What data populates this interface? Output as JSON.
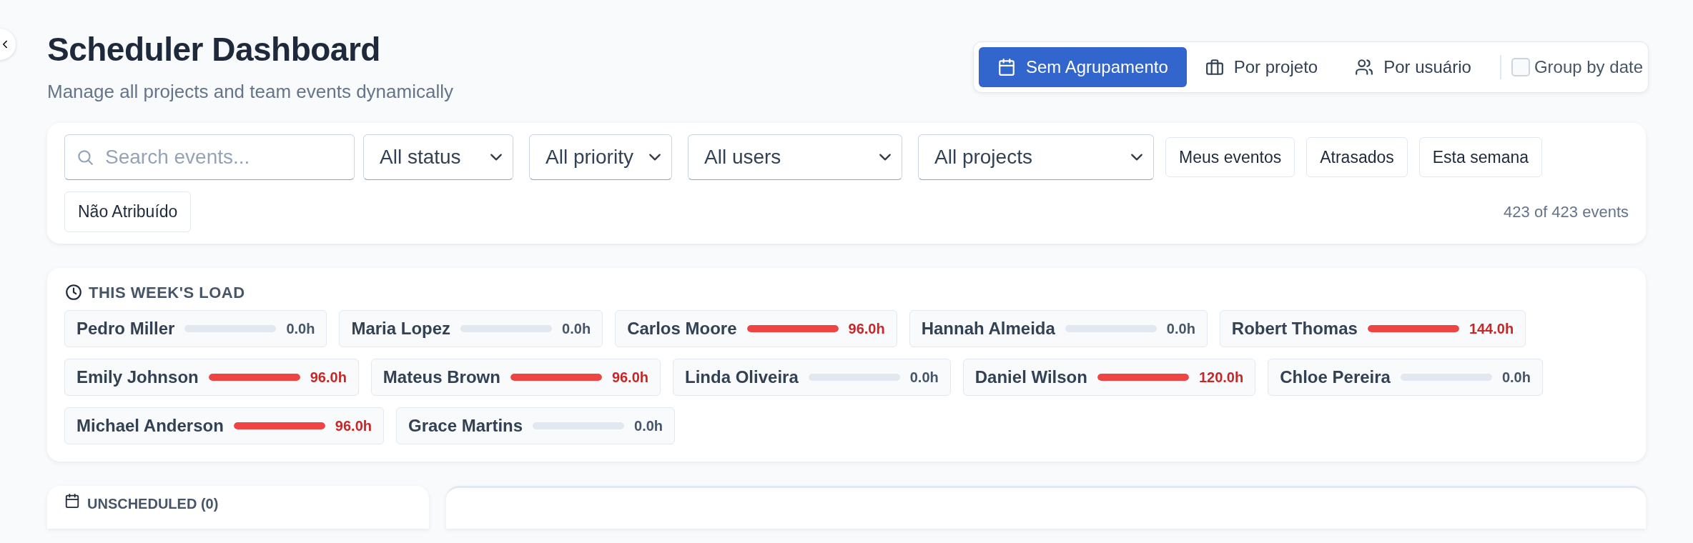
{
  "header": {
    "title": "Scheduler Dashboard",
    "subtitle": "Manage all projects and team events dynamically"
  },
  "grouping": {
    "tabs": [
      {
        "label": "Sem Agrupamento",
        "selected": true
      },
      {
        "label": "Por projeto",
        "selected": false
      },
      {
        "label": "Por usuário",
        "selected": false
      }
    ],
    "group_by_date": {
      "label": "Group by date",
      "checked": false
    }
  },
  "filters": {
    "search": {
      "placeholder": "Search events..."
    },
    "selects": [
      {
        "value": "All status"
      },
      {
        "value": "All priority"
      },
      {
        "value": "All users"
      },
      {
        "value": "All projects"
      }
    ],
    "quick_buttons": [
      "Meus eventos",
      "Atrasados",
      "Esta semana",
      "Não Atribuído"
    ],
    "count": "423 of 423 events"
  },
  "load": {
    "title": "THIS WEEK'S LOAD",
    "users": [
      {
        "name": "Pedro Miller",
        "level": 0,
        "hours": "0.0h",
        "overloaded": false
      },
      {
        "name": "Maria Lopez",
        "level": 0,
        "hours": "0.0h",
        "overloaded": false
      },
      {
        "name": "Carlos Moore",
        "level": 1,
        "hours": "96.0h",
        "overloaded": true
      },
      {
        "name": "Hannah Almeida",
        "level": 0,
        "hours": "0.0h",
        "overloaded": false
      },
      {
        "name": "Robert Thomas",
        "level": 1,
        "hours": "144.0h",
        "overloaded": true
      },
      {
        "name": "Emily Johnson",
        "level": 1,
        "hours": "96.0h",
        "overloaded": true
      },
      {
        "name": "Mateus Brown",
        "level": 1,
        "hours": "96.0h",
        "overloaded": true
      },
      {
        "name": "Linda Oliveira",
        "level": 0,
        "hours": "0.0h",
        "overloaded": false
      },
      {
        "name": "Daniel Wilson",
        "level": 1,
        "hours": "120.0h",
        "overloaded": true
      },
      {
        "name": "Chloe Pereira",
        "level": 0,
        "hours": "0.0h",
        "overloaded": false
      },
      {
        "name": "Michael Anderson",
        "level": 1,
        "hours": "96.0h",
        "overloaded": true
      },
      {
        "name": "Grace Martins",
        "level": 0,
        "hours": "0.0h",
        "overloaded": false
      }
    ]
  },
  "unscheduled": {
    "title": "UNSCHEDULED (0)"
  }
}
